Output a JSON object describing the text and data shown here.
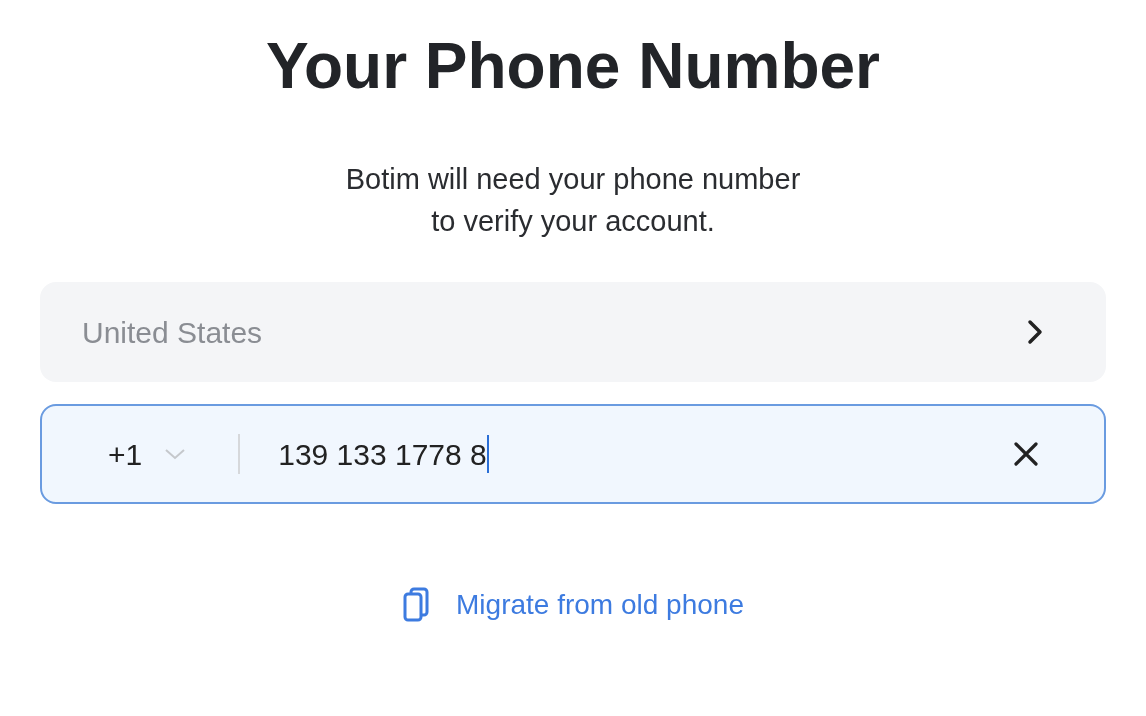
{
  "title": "Your Phone Number",
  "subtitle_lines": [
    "Botim will need your phone number",
    "to verify your account."
  ],
  "country": {
    "placeholder": "United States"
  },
  "phone": {
    "code": "+1",
    "value": "139 133 1778 8",
    "focused": true
  },
  "migrate_link": "Migrate from old phone"
}
